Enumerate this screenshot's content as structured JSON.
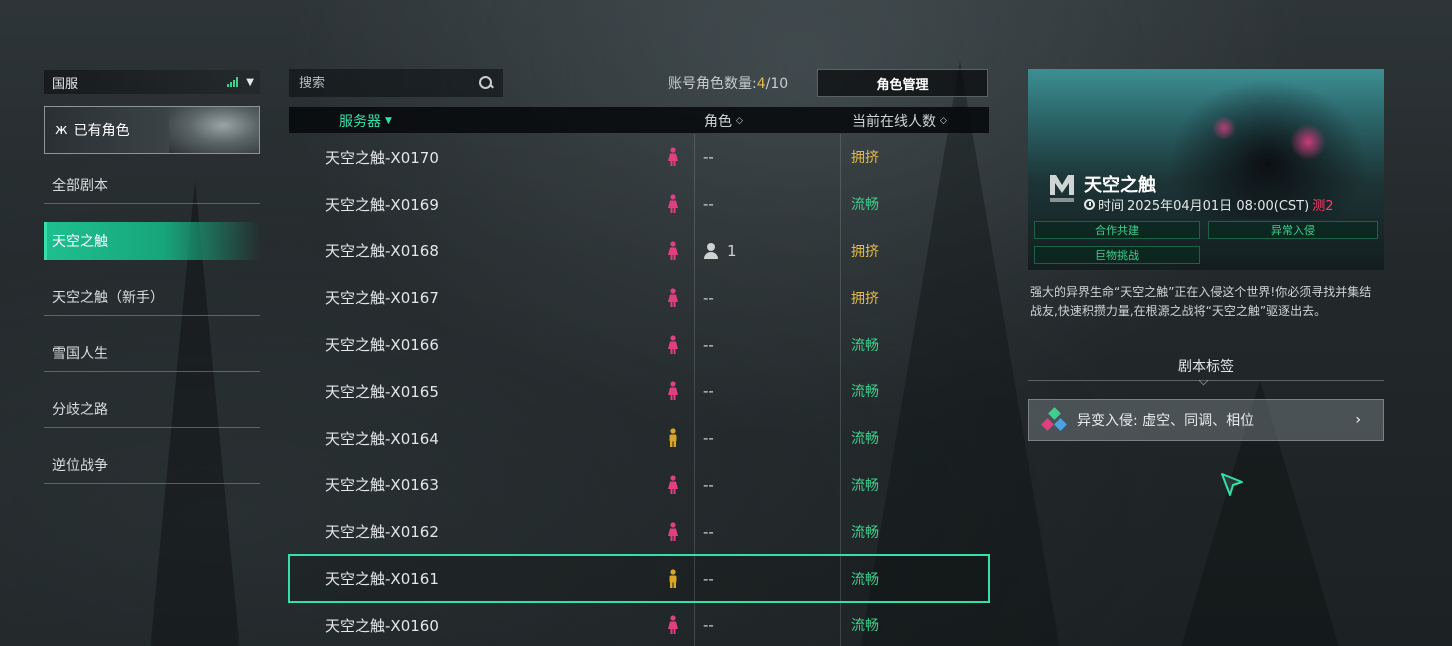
{
  "sidebar": {
    "region": "国服",
    "owned_characters": "已有角色",
    "items": [
      {
        "label": "全部剧本",
        "active": false
      },
      {
        "label": "天空之触",
        "active": true
      },
      {
        "label": "天空之触（新手）",
        "active": false
      },
      {
        "label": "雪国人生",
        "active": false
      },
      {
        "label": "分歧之路",
        "active": false
      },
      {
        "label": "逆位战争",
        "active": false
      }
    ]
  },
  "toolbar": {
    "search_placeholder": "搜索",
    "account_count_label": "账号角色数量:",
    "account_count_current": "4",
    "account_count_sep": "/",
    "account_count_max": "10",
    "role_management": "角色管理"
  },
  "table": {
    "headers": {
      "server": "服务器",
      "role": "角色",
      "online": "当前在线人数"
    },
    "rows": [
      {
        "name": "天空之触-X0170",
        "gender": "female",
        "role": "--",
        "status": "拥挤",
        "status_type": "crowded"
      },
      {
        "name": "天空之触-X0169",
        "gender": "female",
        "role": "--",
        "status": "流畅",
        "status_type": "smooth"
      },
      {
        "name": "天空之触-X0168",
        "gender": "female",
        "role": "1",
        "status": "拥挤",
        "status_type": "crowded"
      },
      {
        "name": "天空之触-X0167",
        "gender": "female",
        "role": "--",
        "status": "拥挤",
        "status_type": "crowded"
      },
      {
        "name": "天空之触-X0166",
        "gender": "female",
        "role": "--",
        "status": "流畅",
        "status_type": "smooth"
      },
      {
        "name": "天空之触-X0165",
        "gender": "female",
        "role": "--",
        "status": "流畅",
        "status_type": "smooth"
      },
      {
        "name": "天空之触-X0164",
        "gender": "male",
        "role": "--",
        "status": "流畅",
        "status_type": "smooth"
      },
      {
        "name": "天空之触-X0163",
        "gender": "female",
        "role": "--",
        "status": "流畅",
        "status_type": "smooth"
      },
      {
        "name": "天空之触-X0162",
        "gender": "female",
        "role": "--",
        "status": "流畅",
        "status_type": "smooth"
      },
      {
        "name": "天空之触-X0161",
        "gender": "male",
        "role": "--",
        "status": "流畅",
        "status_type": "smooth",
        "selected": true
      },
      {
        "name": "天空之触-X0160",
        "gender": "female",
        "role": "--",
        "status": "流畅",
        "status_type": "smooth"
      }
    ]
  },
  "detail": {
    "title": "天空之触",
    "time_label": "时间",
    "time_value": "2025年04月01日 08:00(CST)",
    "time_extra": "测2",
    "tags": [
      "合作共建",
      "异常入侵",
      "巨物挑战"
    ],
    "description": "强大的异界生命“天空之触”正在入侵这个世界!你必须寻找并集结战友,快速积攒力量,在根源之战将“天空之触”驱逐出去。",
    "section_title": "剧本标签",
    "tag_row": "异变入侵: 虚空、同调、相位",
    "tag_row_arrow": "›"
  },
  "colors": {
    "accent": "#35e0a8",
    "smooth": "#3ecf8e",
    "crowded": "#e3b94a",
    "female": "#e0407f",
    "male": "#d9a62a"
  },
  "icons": {
    "region_signal": "signal-bars-icon",
    "region_dropdown": "chevron-down-icon",
    "owned": "butterfly-icon",
    "search": "search-icon",
    "gender": "gender-figure-icon",
    "person": "person-icon",
    "clock": "clock-icon",
    "mutation": "mutation-icon",
    "cursor": "cursor-icon"
  }
}
